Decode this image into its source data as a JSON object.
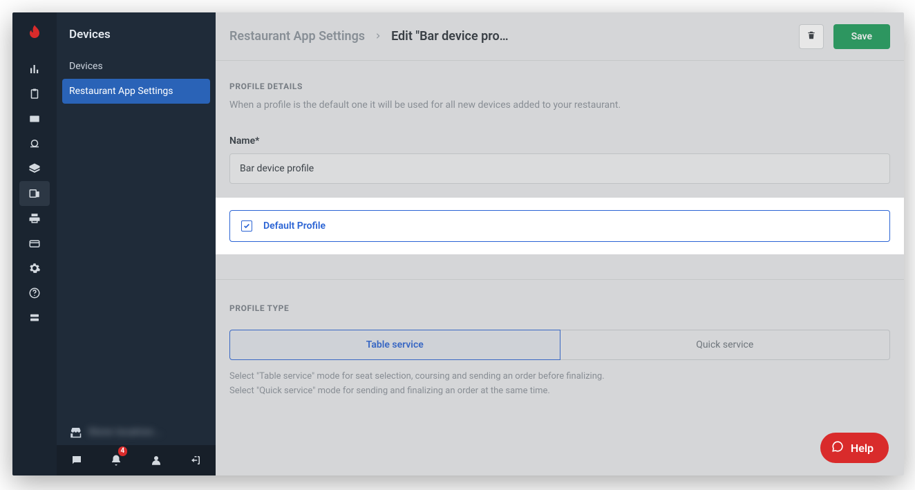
{
  "sidebar": {
    "title": "Devices",
    "items": [
      {
        "label": "Devices"
      },
      {
        "label": "Restaurant App Settings"
      }
    ],
    "store_label": "Store location..."
  },
  "rail": {
    "notification_badge": "4"
  },
  "header": {
    "crumb_link": "Restaurant App Settings",
    "crumb_current": "Edit \"Bar device pro…",
    "save_label": "Save"
  },
  "profile_details": {
    "section_title": "PROFILE DETAILS",
    "help_text": "When a profile is the default one it will be used for all new devices added to your restaurant.",
    "name_label": "Name*",
    "name_value": "Bar device profile",
    "default_checkbox_label": "Default Profile",
    "default_checked": true
  },
  "profile_type": {
    "section_title": "PROFILE TYPE",
    "options": [
      {
        "label": "Table service"
      },
      {
        "label": "Quick service"
      }
    ],
    "help_line_1": "Select \"Table service\" mode for seat selection, coursing and sending an order before finalizing.",
    "help_line_2": "Select \"Quick service\" mode for sending and finalizing an order at the same time."
  },
  "help_button": {
    "label": "Help"
  }
}
